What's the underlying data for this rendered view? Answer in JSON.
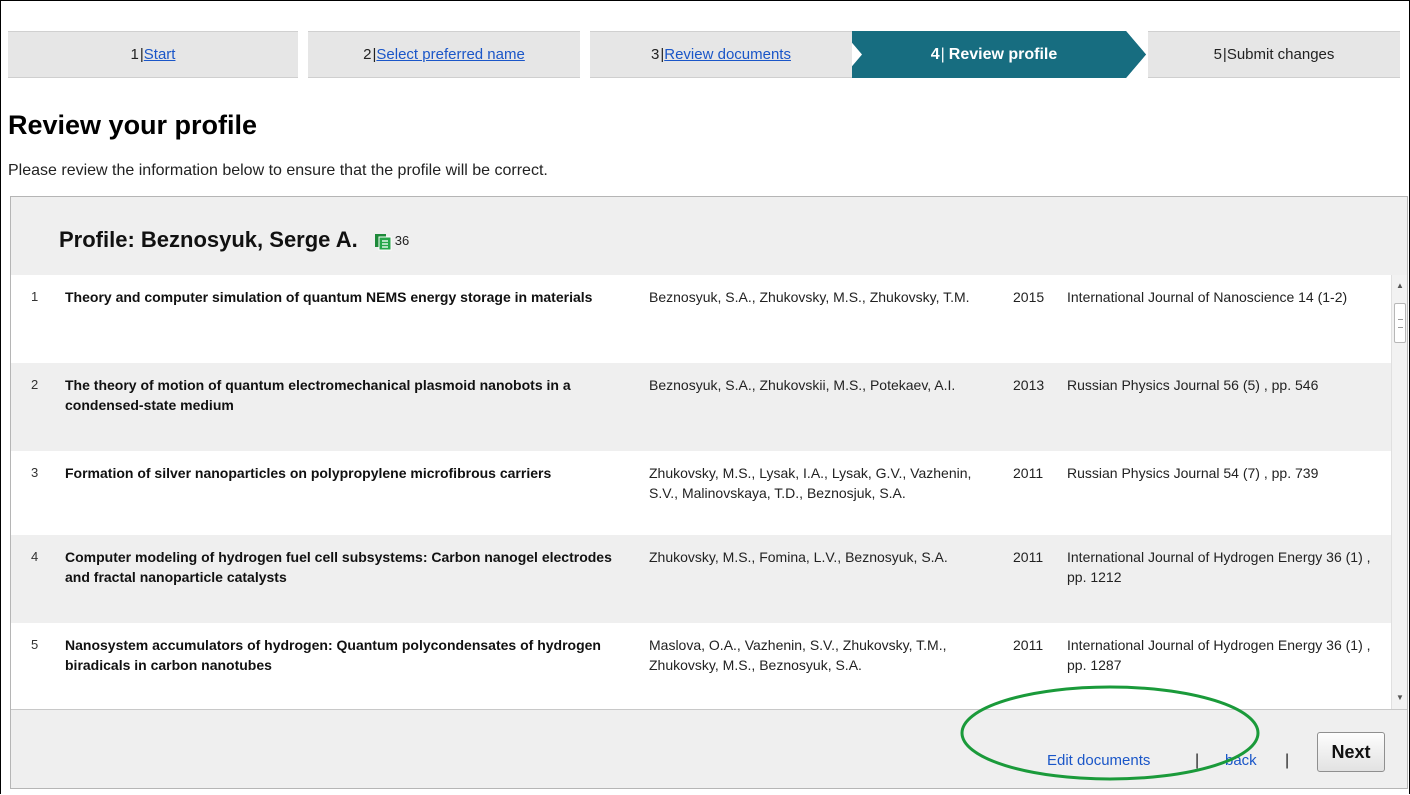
{
  "steps": [
    {
      "number": "1",
      "separator": "|",
      "label": "Start"
    },
    {
      "number": "2",
      "separator": "|",
      "label": "Select preferred name"
    },
    {
      "number": "3",
      "separator": "|",
      "label": "Review documents"
    },
    {
      "number": "4",
      "separator": "|",
      "label": "Review profile"
    },
    {
      "number": "5",
      "separator": "|",
      "label": "Submit changes"
    }
  ],
  "page": {
    "title": "Review your profile",
    "intro": "Please review the information below to ensure that the profile will be correct."
  },
  "profile": {
    "heading": "Profile: Beznosyuk, Serge A.",
    "document_count": "36",
    "icon": "documents-icon"
  },
  "documents": [
    {
      "index": "1",
      "title": "Theory and computer simulation of quantum NEMS energy storage in materials",
      "authors": "Beznosyuk, S.A., Zhukovsky, M.S., Zhukovsky, T.M.",
      "year": "2015",
      "source": "International Journal of Nanoscience 14 (1-2)"
    },
    {
      "index": "2",
      "title": "The theory of motion of quantum electromechanical plasmoid nanobots in a condensed-state medium",
      "authors": "Beznosyuk, S.A., Zhukovskii, M.S., Potekaev, A.I.",
      "year": "2013",
      "source": "Russian Physics Journal 56 (5) , pp. 546"
    },
    {
      "index": "3",
      "title": "Formation of silver nanoparticles on polypropylene microfibrous carriers",
      "authors": "Zhukovsky, M.S., Lysak, I.A., Lysak, G.V., Vazhenin, S.V., Malinovskaya, T.D., Beznosjuk, S.A.",
      "year": "2011",
      "source": "Russian Physics Journal 54 (7) , pp. 739"
    },
    {
      "index": "4",
      "title": "Computer modeling of hydrogen fuel cell subsystems: Carbon nanogel electrodes and fractal nanoparticle catalysts",
      "authors": "Zhukovsky, M.S., Fomina, L.V., Beznosyuk, S.A.",
      "year": "2011",
      "source": "International Journal of Hydrogen Energy 36 (1) , pp. 1212"
    },
    {
      "index": "5",
      "title": "Nanosystem accumulators of hydrogen: Quantum polycondensates of hydrogen biradicals in carbon nanotubes",
      "authors": "Maslova, O.A., Vazhenin, S.V., Zhukovsky, T.M., Zhukovsky, M.S., Beznosyuk, S.A.",
      "year": "2011",
      "source": "International Journal of Hydrogen Energy 36 (1) , pp. 1287"
    }
  ],
  "footer": {
    "edit_documents": "Edit documents",
    "separator": "|",
    "back": "back",
    "next": "Next"
  },
  "colors": {
    "active_step": "#176d80",
    "link": "#1a56c8",
    "highlight_ellipse": "#1a9a3a"
  }
}
